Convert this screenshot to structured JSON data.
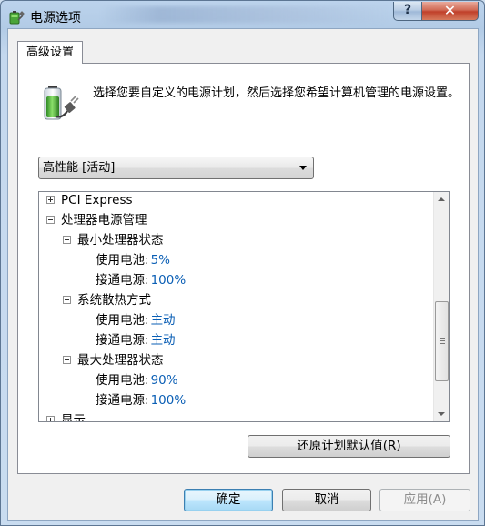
{
  "window": {
    "title": "电源选项",
    "help_label": "?",
    "close_label": "✕"
  },
  "tab": {
    "label": "高级设置"
  },
  "description": "选择您要自定义的电源计划，然后选择您希望计算机管理的电源设置。",
  "plan_select": {
    "selected": "高性能 [活动]"
  },
  "tree": [
    {
      "level": 0,
      "toggle": "plus",
      "label": "PCI Express",
      "value": ""
    },
    {
      "level": 0,
      "toggle": "minus",
      "label": "处理器电源管理",
      "value": ""
    },
    {
      "level": 1,
      "toggle": "minus",
      "label": "最小处理器状态",
      "value": ""
    },
    {
      "level": 2,
      "toggle": "",
      "label": "使用电池:",
      "value": "5%"
    },
    {
      "level": 2,
      "toggle": "",
      "label": "接通电源:",
      "value": "100%"
    },
    {
      "level": 1,
      "toggle": "minus",
      "label": "系统散热方式",
      "value": ""
    },
    {
      "level": 2,
      "toggle": "",
      "label": "使用电池:",
      "value": "主动"
    },
    {
      "level": 2,
      "toggle": "",
      "label": "接通电源:",
      "value": "主动"
    },
    {
      "level": 1,
      "toggle": "minus",
      "label": "最大处理器状态",
      "value": ""
    },
    {
      "level": 2,
      "toggle": "",
      "label": "使用电池:",
      "value": "90%"
    },
    {
      "level": 2,
      "toggle": "",
      "label": "接通电源:",
      "value": "100%"
    },
    {
      "level": 0,
      "toggle": "plus",
      "label": "显示",
      "value": ""
    }
  ],
  "buttons": {
    "restore_defaults": "还原计划默认值(R)",
    "ok": "确定",
    "cancel": "取消",
    "apply": "应用(A)"
  },
  "icons": {
    "app": "power-options-icon",
    "panel": "battery-plug-icon"
  },
  "colors": {
    "value_text": "#0b5fb5",
    "titlebar": "#b2cbe6",
    "close_button": "#c0402a"
  }
}
